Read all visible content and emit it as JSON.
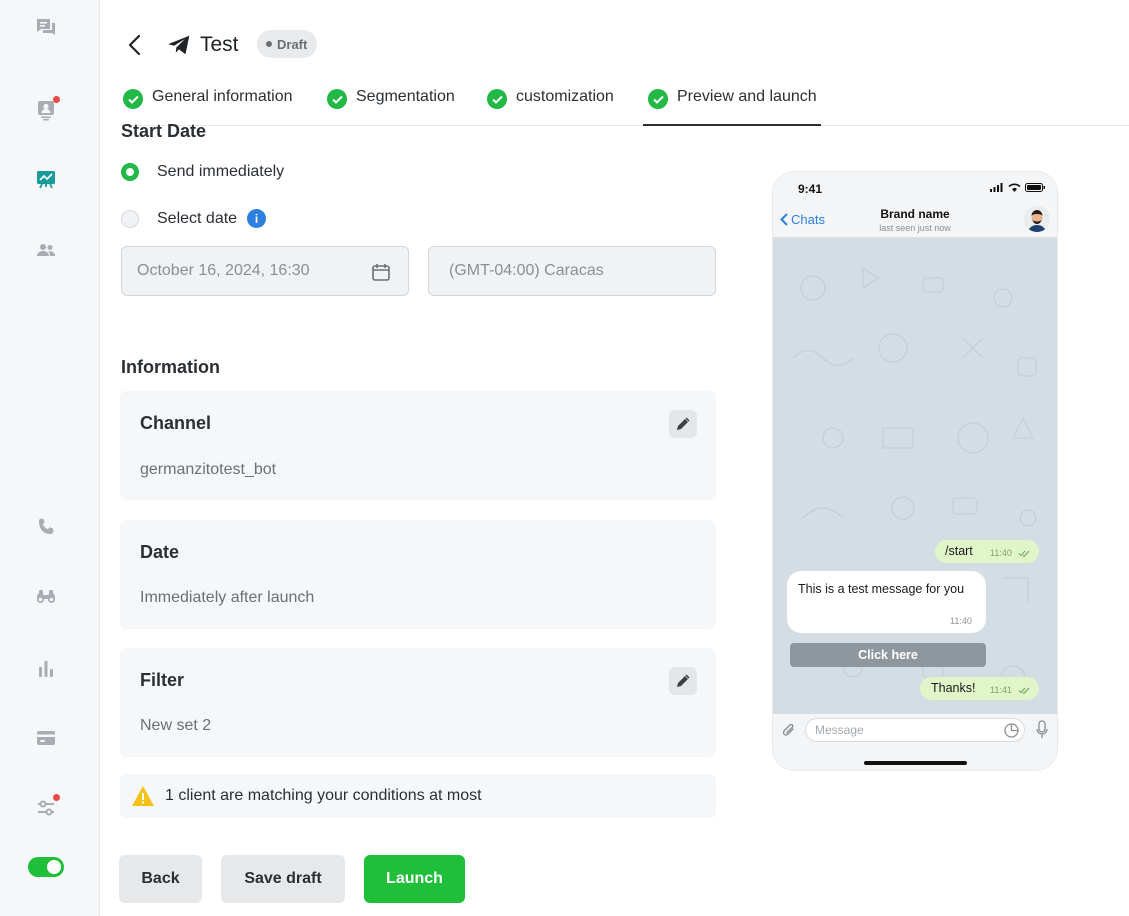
{
  "sidebar": {
    "icons": [
      "conversations-icon",
      "contacts-icon",
      "campaigns-icon",
      "team-icon",
      "phone-icon",
      "binoculars-icon",
      "stats-icon",
      "billing-icon",
      "settings-icon"
    ],
    "active_color": "#1a9b9b",
    "toggle_state": "on"
  },
  "header": {
    "title": "Test",
    "status_badge": "Draft"
  },
  "tabs": [
    {
      "label": "General information"
    },
    {
      "label": "Segmentation"
    },
    {
      "label": "customization"
    },
    {
      "label": "Preview and launch"
    }
  ],
  "start_date": {
    "title": "Start Date",
    "option_immediately": "Send immediately",
    "option_select_date": "Select date",
    "info_symbol": "i",
    "date_value": "October 16, 2024, 16:30",
    "timezone_value": "(GMT-04:00) Caracas"
  },
  "information": {
    "title": "Information",
    "channel": {
      "label": "Channel",
      "value": "germanzitotest_bot"
    },
    "date": {
      "label": "Date",
      "value": "Immediately after launch"
    },
    "filter": {
      "label": "Filter",
      "value": "New set 2"
    },
    "warning": "1 client are matching your conditions at most"
  },
  "footer": {
    "back": "Back",
    "save_draft": "Save draft",
    "launch": "Launch"
  },
  "preview": {
    "time": "9:41",
    "back_label": "Chats",
    "brand_name": "Brand name",
    "last_seen": "last seen just now",
    "messages": [
      {
        "dir": "out",
        "text": "/start",
        "time": "11:40"
      },
      {
        "dir": "in",
        "text": "This is a test message for you",
        "time": "11:40"
      },
      {
        "dir": "out",
        "text": "Thanks!",
        "time": "11:41"
      }
    ],
    "button_label": "Click here",
    "input_placeholder": "Message"
  },
  "colors": {
    "accent_green": "#21b845",
    "launch_green": "#1fbf3a",
    "info_blue": "#2d7fe0",
    "notification_red": "#ec4a45"
  }
}
